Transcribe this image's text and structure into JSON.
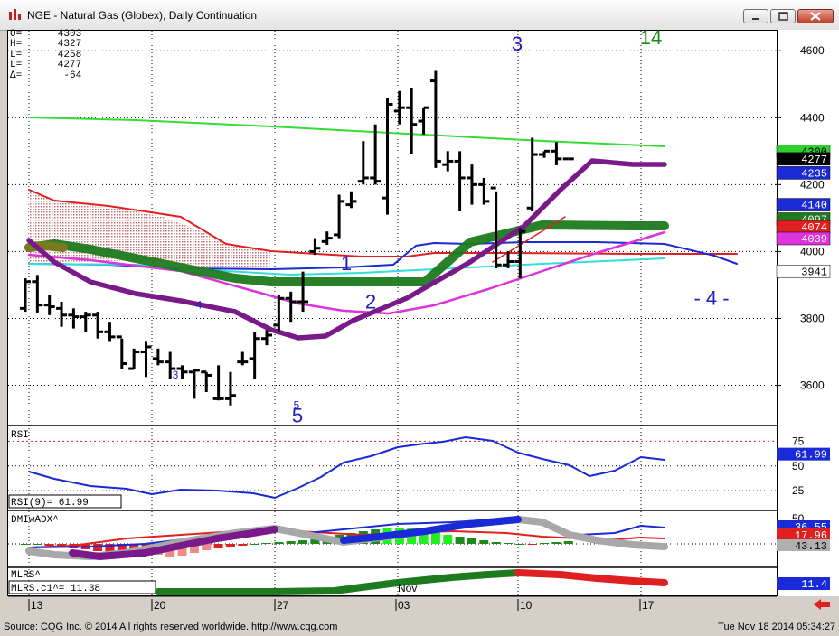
{
  "window": {
    "title": "NGE - Natural Gas (Globex), Daily Continuation"
  },
  "ohlc_box": {
    "lines": [
      {
        "k": "O=",
        "v": "4303"
      },
      {
        "k": "H=",
        "v": "4327"
      },
      {
        "k": "L=",
        "v": "4258"
      },
      {
        "k": "L=",
        "v": "4277"
      },
      {
        "k": "Δ=",
        "v": "-64"
      }
    ]
  },
  "panels": {
    "rsi": {
      "title": "RSI",
      "readout": "RSI(9)=    61.99"
    },
    "dmi": {
      "title": "DMIwADX^"
    },
    "mlrs": {
      "title": "MLRS^",
      "readout": "MLRS.c1^=      11.38"
    }
  },
  "status": {
    "source": "Source: CQG Inc. © 2014 All rights reserved worldwide. http://www.cqg.com",
    "timestamp": "Tue Nov 18 2014 05:34:27"
  },
  "colors": {
    "green_ma": "#33dd33",
    "purple_ma": "#7a1a8a",
    "darkgreen_ma": "#1e7a1e",
    "magenta_ma": "#dd33dd",
    "cyan_ma": "#33dddd",
    "blue_ma": "#1a2ad6",
    "red_ma": "#e02020",
    "wave_label": "#2020c0",
    "count_label": "#1a8a1a"
  },
  "chart_data": {
    "type": "bar",
    "instrument": "NGE - Natural Gas (Globex), Daily Continuation",
    "y_axis": {
      "range": [
        3480,
        4660
      ],
      "ticks": [
        3600,
        3800,
        4000,
        4200,
        4400,
        4600
      ]
    },
    "x_axis": {
      "date_labels": [
        "13",
        "20",
        "27",
        "03",
        "Nov",
        "10",
        "17"
      ]
    },
    "ohlc_bars": [
      {
        "o": 3830,
        "h": 3920,
        "l": 3820,
        "c": 3910
      },
      {
        "o": 3910,
        "h": 3930,
        "l": 3815,
        "c": 3840
      },
      {
        "o": 3840,
        "h": 3870,
        "l": 3810,
        "c": 3835
      },
      {
        "o": 3830,
        "h": 3850,
        "l": 3775,
        "c": 3810
      },
      {
        "o": 3810,
        "h": 3830,
        "l": 3770,
        "c": 3805
      },
      {
        "o": 3805,
        "h": 3820,
        "l": 3760,
        "c": 3810
      },
      {
        "o": 3810,
        "h": 3820,
        "l": 3740,
        "c": 3760
      },
      {
        "o": 3760,
        "h": 3790,
        "l": 3730,
        "c": 3745
      },
      {
        "o": 3745,
        "h": 3740,
        "l": 3650,
        "c": 3665
      },
      {
        "o": 3650,
        "h": 3710,
        "l": 3650,
        "c": 3700
      },
      {
        "o": 3700,
        "h": 3730,
        "l": 3625,
        "c": 3715
      },
      {
        "o": 3680,
        "h": 3710,
        "l": 3660,
        "c": 3670
      },
      {
        "o": 3670,
        "h": 3700,
        "l": 3620,
        "c": 3650
      },
      {
        "o": 3650,
        "h": 3660,
        "l": 3620,
        "c": 3640
      },
      {
        "o": 3640,
        "h": 3650,
        "l": 3560,
        "c": 3645
      },
      {
        "o": 3640,
        "h": 3640,
        "l": 3580,
        "c": 3630
      },
      {
        "o": 3560,
        "h": 3660,
        "l": 3555,
        "c": 3560
      },
      {
        "o": 3560,
        "h": 3640,
        "l": 3540,
        "c": 3570
      },
      {
        "o": 3670,
        "h": 3700,
        "l": 3660,
        "c": 3670
      },
      {
        "o": 3680,
        "h": 3760,
        "l": 3620,
        "c": 3740
      },
      {
        "o": 3740,
        "h": 3765,
        "l": 3720,
        "c": 3750
      },
      {
        "o": 3780,
        "h": 3870,
        "l": 3760,
        "c": 3860
      },
      {
        "o": 3860,
        "h": 3880,
        "l": 3790,
        "c": 3850
      },
      {
        "o": 3850,
        "h": 3940,
        "l": 3820,
        "c": 3850
      },
      {
        "o": 4000,
        "h": 4040,
        "l": 3990,
        "c": 4010
      },
      {
        "o": 4030,
        "h": 4060,
        "l": 4020,
        "c": 4040
      },
      {
        "o": 4050,
        "h": 4170,
        "l": 4040,
        "c": 4150
      },
      {
        "o": 4140,
        "h": 4180,
        "l": 4130,
        "c": 4150
      },
      {
        "o": 4210,
        "h": 4330,
        "l": 4200,
        "c": 4220
      },
      {
        "o": 4220,
        "h": 4380,
        "l": 4200,
        "c": 4210
      },
      {
        "o": 4160,
        "h": 4460,
        "l": 4110,
        "c": 4440
      },
      {
        "o": 4420,
        "h": 4480,
        "l": 4380,
        "c": 4430
      },
      {
        "o": 4430,
        "h": 4490,
        "l": 4290,
        "c": 4380
      },
      {
        "o": 4390,
        "h": 4430,
        "l": 4350,
        "c": 4430
      },
      {
        "o": 4510,
        "h": 4540,
        "l": 4250,
        "c": 4270
      },
      {
        "o": 4260,
        "h": 4300,
        "l": 4240,
        "c": 4270
      },
      {
        "o": 4270,
        "h": 4300,
        "l": 4120,
        "c": 4220
      },
      {
        "o": 4220,
        "h": 4260,
        "l": 4140,
        "c": 4200
      },
      {
        "o": 4200,
        "h": 4220,
        "l": 4140,
        "c": 4150
      },
      {
        "o": 4190,
        "h": 4180,
        "l": 3950,
        "c": 3960
      },
      {
        "o": 3960,
        "h": 4000,
        "l": 3950,
        "c": 3970
      },
      {
        "o": 3970,
        "h": 4070,
        "l": 3920,
        "c": 4060
      },
      {
        "o": 4130,
        "h": 4340,
        "l": 4120,
        "c": 4290
      },
      {
        "o": 4290,
        "h": 4300,
        "l": 4280,
        "c": 4300
      },
      {
        "o": 4300,
        "h": 4327,
        "l": 4258,
        "c": 4277
      },
      {
        "o": 4277,
        "h": 4277,
        "l": 4277,
        "c": 4277
      }
    ],
    "price_labels": [
      {
        "text": "4300",
        "value": 4300,
        "bg": "#2ed02e",
        "fg": "#000000"
      },
      {
        "text": "4277",
        "value": 4277,
        "bg": "#000000",
        "fg": "#ffffff"
      },
      {
        "text": "4235",
        "value": 4235,
        "bg": "#1a2ad6",
        "fg": "#ffffff"
      },
      {
        "text": "4140",
        "value": 4140,
        "bg": "#1a2ad6",
        "fg": "#ffffff"
      },
      {
        "text": "4097",
        "value": 4097,
        "bg": "#1e7a1e",
        "fg": "#ffffff"
      },
      {
        "text": "4074",
        "value": 4074,
        "bg": "#e02020",
        "fg": "#ffffff"
      },
      {
        "text": "4039",
        "value": 4039,
        "bg": "#dd33dd",
        "fg": "#ffffff"
      },
      {
        "text": "3941",
        "value": 3941,
        "bg": "#ffffff",
        "fg": "#000000"
      }
    ],
    "wave_labels": [
      {
        "text": "3",
        "value": 4600,
        "size": "large"
      },
      {
        "text": "14",
        "value": 4620,
        "size": "large"
      },
      {
        "text": "1",
        "value": 3945,
        "size": "large"
      },
      {
        "text": "2",
        "value": 3830,
        "size": "large"
      },
      {
        "text": "4",
        "value": 3830,
        "size": "small"
      },
      {
        "text": "3",
        "value": 3620,
        "size": "small"
      },
      {
        "text": "5",
        "value": 3530,
        "size": "small"
      },
      {
        "text": "5",
        "value": 3490,
        "size": "large"
      },
      {
        "text": "- 4 -",
        "value": 3840,
        "size": "large"
      }
    ],
    "rsi": {
      "ticks": [
        25,
        50,
        75
      ],
      "last": "61.99"
    },
    "dmi": {
      "ticks": [
        50
      ],
      "labels": [
        "36.55",
        "17.96",
        "43.13"
      ]
    },
    "mlrs": {
      "last": "11.4"
    }
  }
}
